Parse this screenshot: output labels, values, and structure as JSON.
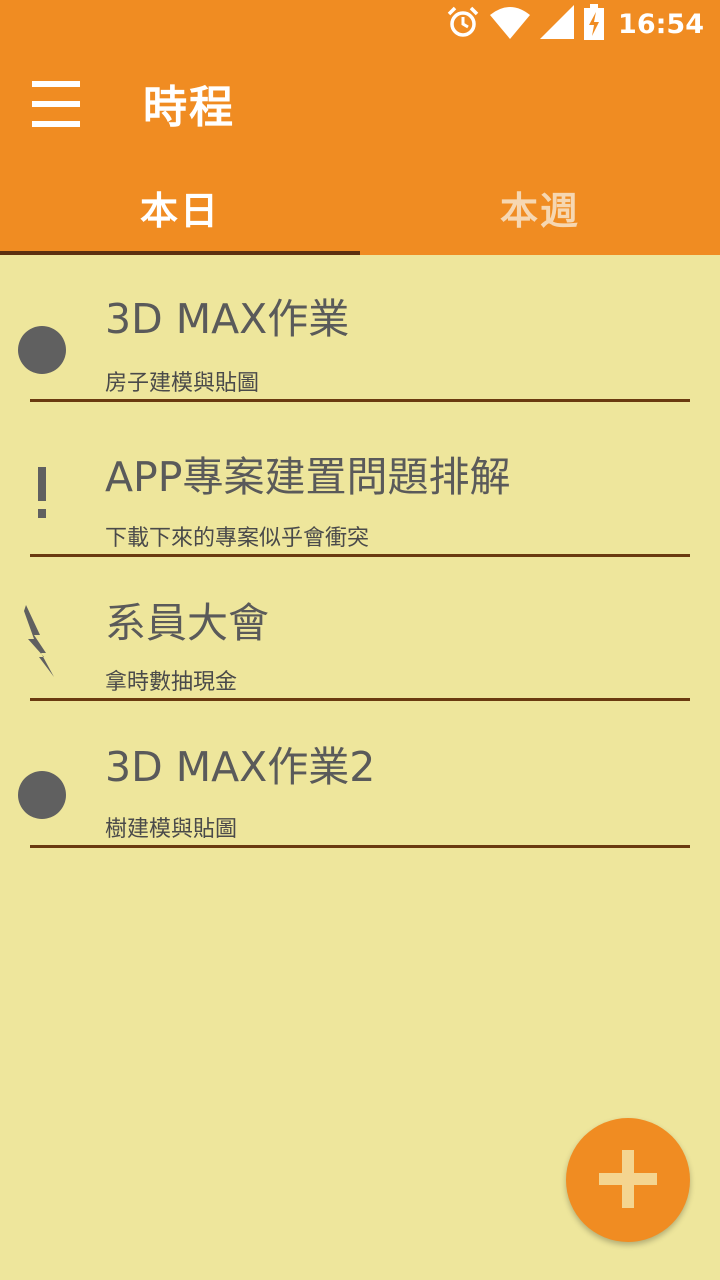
{
  "status_bar": {
    "time": "16:54",
    "icons": [
      "alarm-icon",
      "wifi-icon",
      "signal-icon",
      "battery-charging-icon"
    ]
  },
  "app_bar": {
    "title": "時程",
    "menu_icon": "hamburger-menu-icon",
    "background": "#F08C22"
  },
  "tabs": [
    {
      "label": "本日",
      "selected": true
    },
    {
      "label": "本週",
      "selected": false
    }
  ],
  "schedule": [
    {
      "icon": "dot-icon",
      "title": "3D MAX作業",
      "subtitle": "房子建模與貼圖"
    },
    {
      "icon": "exclamation-icon",
      "title": "APP專案建置問題排解",
      "subtitle": "下載下來的專案似乎會衝突"
    },
    {
      "icon": "lightning-icon",
      "title": "系員大會",
      "subtitle": "拿時數抽現金"
    },
    {
      "icon": "dot-icon",
      "title": "3D MAX作業2",
      "subtitle": "樹建模與貼圖"
    }
  ],
  "fab": {
    "icon": "plus-icon"
  },
  "colors": {
    "accent": "#F08C22",
    "background": "#EEE69C",
    "divider": "#6A3A10",
    "icon_gray": "#606060"
  }
}
